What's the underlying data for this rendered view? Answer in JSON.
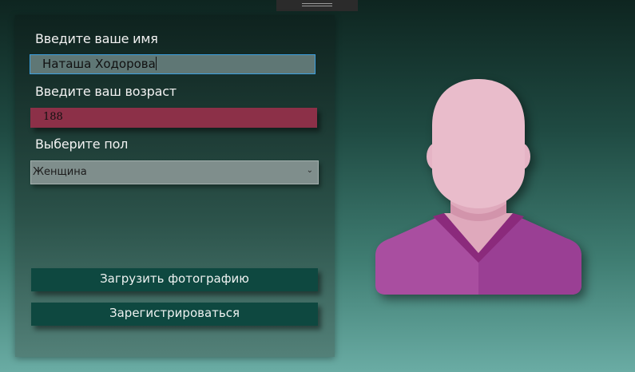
{
  "form": {
    "name_label": "Введите ваше имя",
    "name_value": "Наташа Ходорова",
    "age_label": "Введите ваш возраст",
    "age_value": "188",
    "sex_label": "Выберите пол",
    "sex_selected": "Женщина",
    "upload_label": "Загрузить фотографию",
    "register_label": "Зарегистрироваться"
  },
  "icons": {
    "select_arrow": "chevron-down-icon",
    "avatar": "user-avatar-placeholder"
  },
  "colors": {
    "age_field": "#8c3048",
    "button": "#0e4840",
    "focus_border": "#3da0e0",
    "avatar_skin": "#e9bccb",
    "avatar_shirt": "#a94ea0"
  }
}
